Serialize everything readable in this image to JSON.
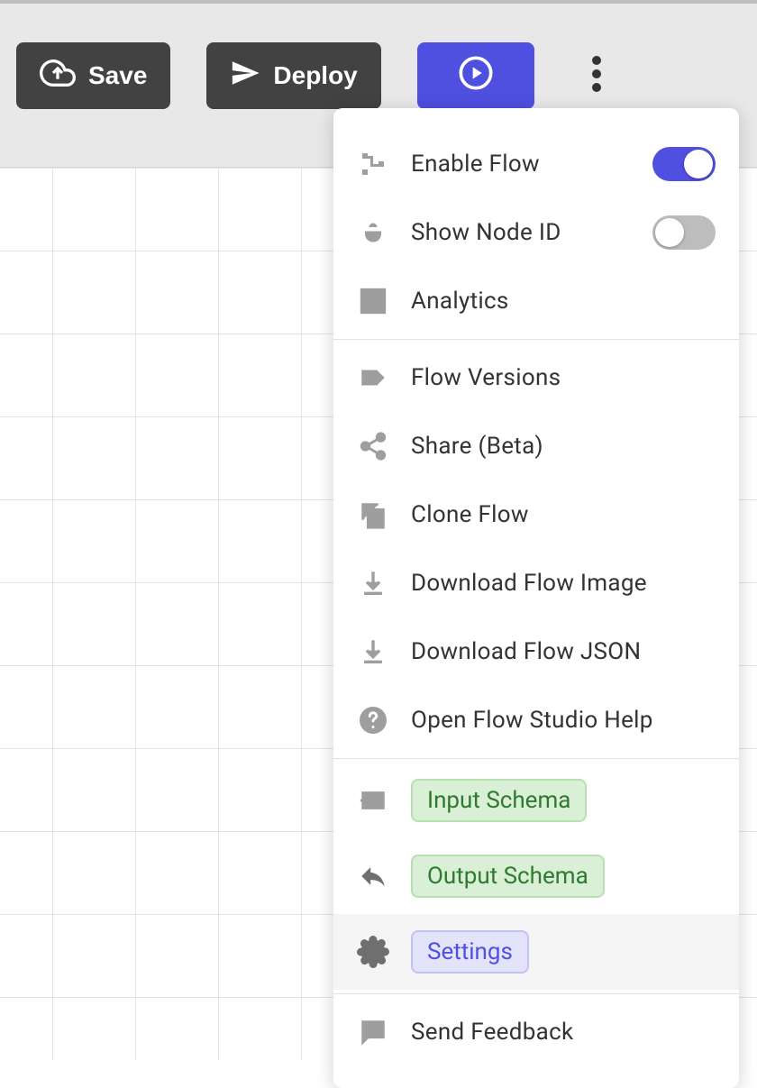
{
  "toolbar": {
    "save_label": "Save",
    "deploy_label": "Deploy"
  },
  "menu": {
    "enable_flow": {
      "label": "Enable Flow",
      "on": true
    },
    "show_node_id": {
      "label": "Show Node ID",
      "on": false
    },
    "analytics": {
      "label": "Analytics"
    },
    "flow_versions": {
      "label": "Flow Versions"
    },
    "share": {
      "label": "Share (Beta)"
    },
    "clone": {
      "label": "Clone Flow"
    },
    "download_image": {
      "label": "Download Flow Image"
    },
    "download_json": {
      "label": "Download Flow JSON"
    },
    "help": {
      "label": "Open Flow Studio Help"
    },
    "input_schema": {
      "label": "Input Schema"
    },
    "output_schema": {
      "label": "Output Schema"
    },
    "settings": {
      "label": "Settings"
    },
    "feedback": {
      "label": "Send Feedback"
    }
  }
}
